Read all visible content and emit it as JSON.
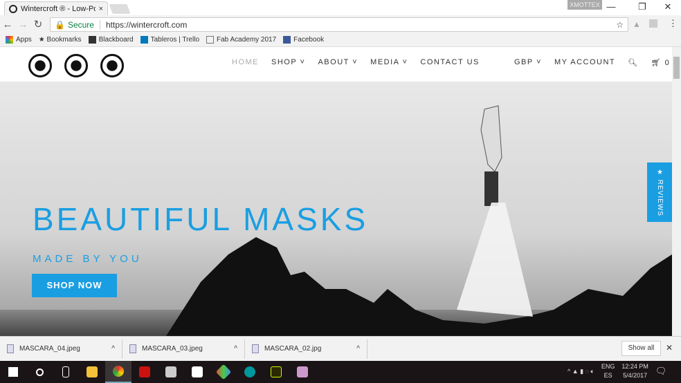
{
  "browser": {
    "tab_title": "Wintercroft ® - Low-Poly",
    "user": "XMOTTEX",
    "secure_label": "Secure",
    "url": "https://wintercroft.com",
    "bookmarks": [
      "Apps",
      "Bookmarks",
      "Blackboard",
      "Tableros | Trello",
      "Fab Academy 2017",
      "Facebook"
    ]
  },
  "site": {
    "nav": [
      "HOME",
      "SHOP ˅",
      "ABOUT ˅",
      "MEDIA ˅",
      "CONTACT US"
    ],
    "currency": "GBP ˅",
    "account": "MY ACCOUNT",
    "cart_count": "0"
  },
  "hero": {
    "title": "BEAUTIFUL MASKS",
    "subtitle": "MADE BY YOU",
    "cta": "SHOP NOW",
    "reviews": "★ REVIEWS"
  },
  "accent": "#1a9ee2",
  "downloads": {
    "items": [
      "MASCARA_04.jpeg",
      "MASCARA_03.jpeg",
      "MASCARA_02.jpg"
    ],
    "show_all": "Show all"
  },
  "taskbar": {
    "lang1": "ENG",
    "lang2": "ES",
    "time": "12:24 PM",
    "date": "5/4/2017"
  }
}
